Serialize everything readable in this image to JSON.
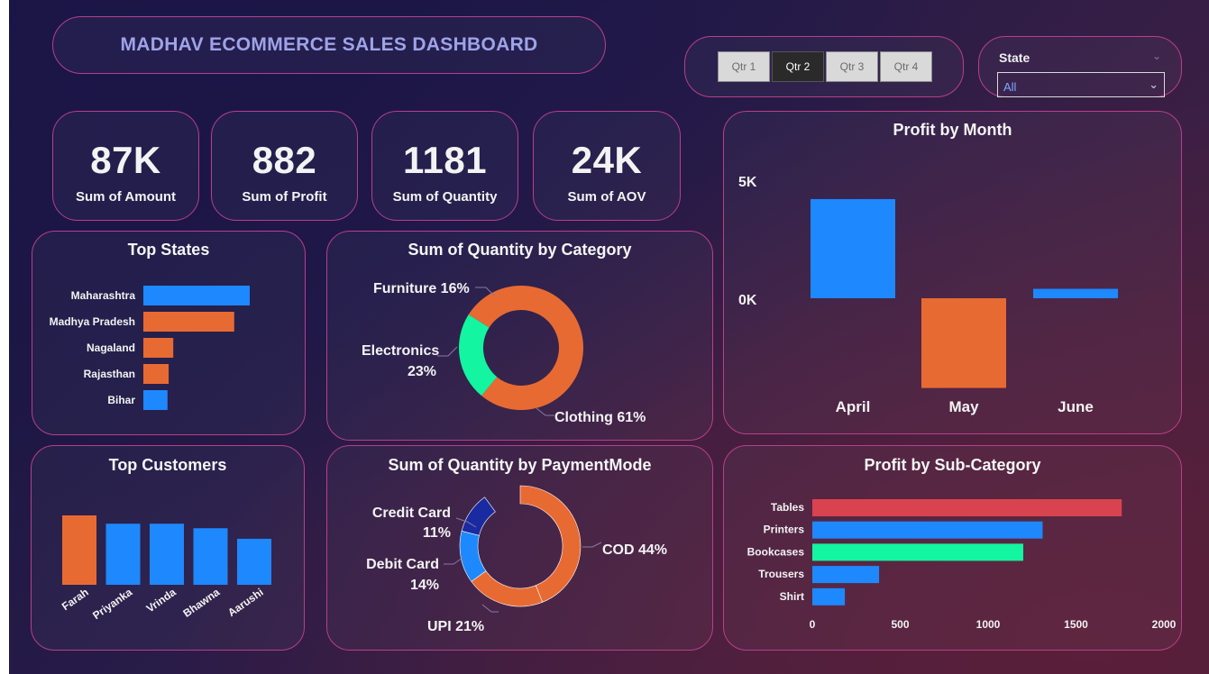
{
  "header": {
    "title": "MADHAV ECOMMERCE SALES DASHBOARD"
  },
  "quarter_slicer": {
    "buttons": [
      {
        "label": "Qtr 1",
        "selected": false
      },
      {
        "label": "Qtr 2",
        "selected": true
      },
      {
        "label": "Qtr 3",
        "selected": false
      },
      {
        "label": "Qtr 4",
        "selected": false
      }
    ]
  },
  "state_slicer": {
    "label": "State",
    "value": "All"
  },
  "kpis": [
    {
      "value": "87K",
      "label": "Sum of Amount"
    },
    {
      "value": "882",
      "label": "Sum of Profit"
    },
    {
      "value": "1181",
      "label": "Sum of Quantity"
    },
    {
      "value": "24K",
      "label": "Sum of AOV"
    }
  ],
  "colors": {
    "blue": "#1e88ff",
    "orange": "#e86a33",
    "green": "#13f5a0",
    "red": "#d9434f",
    "navy": "#1a2aa0",
    "panel_border": "#b83f8a"
  },
  "chart_data": [
    {
      "id": "top_states",
      "type": "bar",
      "orientation": "horizontal",
      "title": "Top States",
      "categories": [
        "Maharashtra",
        "Madhya Pradesh",
        "Nagaland",
        "Rajasthan",
        "Bihar"
      ],
      "values": [
        18500,
        15800,
        5200,
        4400,
        4200
      ],
      "colors": [
        "#1e88ff",
        "#e86a33",
        "#e86a33",
        "#e86a33",
        "#1e88ff"
      ]
    },
    {
      "id": "quantity_by_category",
      "type": "pie",
      "donut": true,
      "title": "Sum of Quantity by Category",
      "slices": [
        {
          "label": "Clothing",
          "percent": 61,
          "color": "#e86a33"
        },
        {
          "label": "Electronics",
          "percent": 23,
          "color": "#13f5a0"
        },
        {
          "label": "Furniture",
          "percent": 16,
          "color": "#e86a33"
        }
      ],
      "label_texts": [
        "Furniture 16%",
        "Electronics",
        "23%",
        "Clothing 61%"
      ]
    },
    {
      "id": "profit_by_month",
      "type": "bar",
      "title": "Profit by Month",
      "categories": [
        "April",
        "May",
        "June"
      ],
      "values": [
        4200,
        -3800,
        400
      ],
      "colors": [
        "#1e88ff",
        "#e86a33",
        "#1e88ff"
      ],
      "ytick_labels": [
        "5K",
        "0K"
      ],
      "yticks": [
        5000,
        0
      ],
      "ylim": [
        -4000,
        5000
      ]
    },
    {
      "id": "top_customers",
      "type": "bar",
      "title": "Top Customers",
      "categories": [
        "Farah",
        "Priyanka",
        "Vrinda",
        "Bhawna",
        "Aarushi"
      ],
      "values": [
        9200,
        8100,
        8100,
        7500,
        6100
      ],
      "colors": [
        "#e86a33",
        "#1e88ff",
        "#1e88ff",
        "#1e88ff",
        "#1e88ff"
      ]
    },
    {
      "id": "quantity_by_payment",
      "type": "pie",
      "donut": true,
      "title": "Sum of Quantity by PaymentMode",
      "slices": [
        {
          "label": "COD",
          "percent": 44,
          "color": "#e86a33"
        },
        {
          "label": "UPI",
          "percent": 21,
          "color": "#e86a33"
        },
        {
          "label": "Debit Card",
          "percent": 14,
          "color": "#1e88ff"
        },
        {
          "label": "Credit Card",
          "percent": 11,
          "color": "#1a2aa0"
        }
      ],
      "label_texts": [
        "Credit Card",
        "11%",
        "Debit Card",
        "14%",
        "UPI 21%",
        "COD 44%"
      ]
    },
    {
      "id": "profit_by_subcategory",
      "type": "bar",
      "orientation": "horizontal",
      "title": "Profit by Sub-Category",
      "categories": [
        "Tables",
        "Printers",
        "Bookcases",
        "Trousers",
        "Shirt"
      ],
      "values": [
        1760,
        1310,
        1200,
        380,
        185
      ],
      "colors": [
        "#d9434f",
        "#1e88ff",
        "#13f5a0",
        "#1e88ff",
        "#1e88ff"
      ],
      "xticks": [
        0,
        500,
        1000,
        1500,
        2000
      ],
      "xtick_labels": [
        "0",
        "500",
        "1000",
        "1500",
        "2000"
      ],
      "xlim": [
        0,
        2000
      ]
    }
  ]
}
